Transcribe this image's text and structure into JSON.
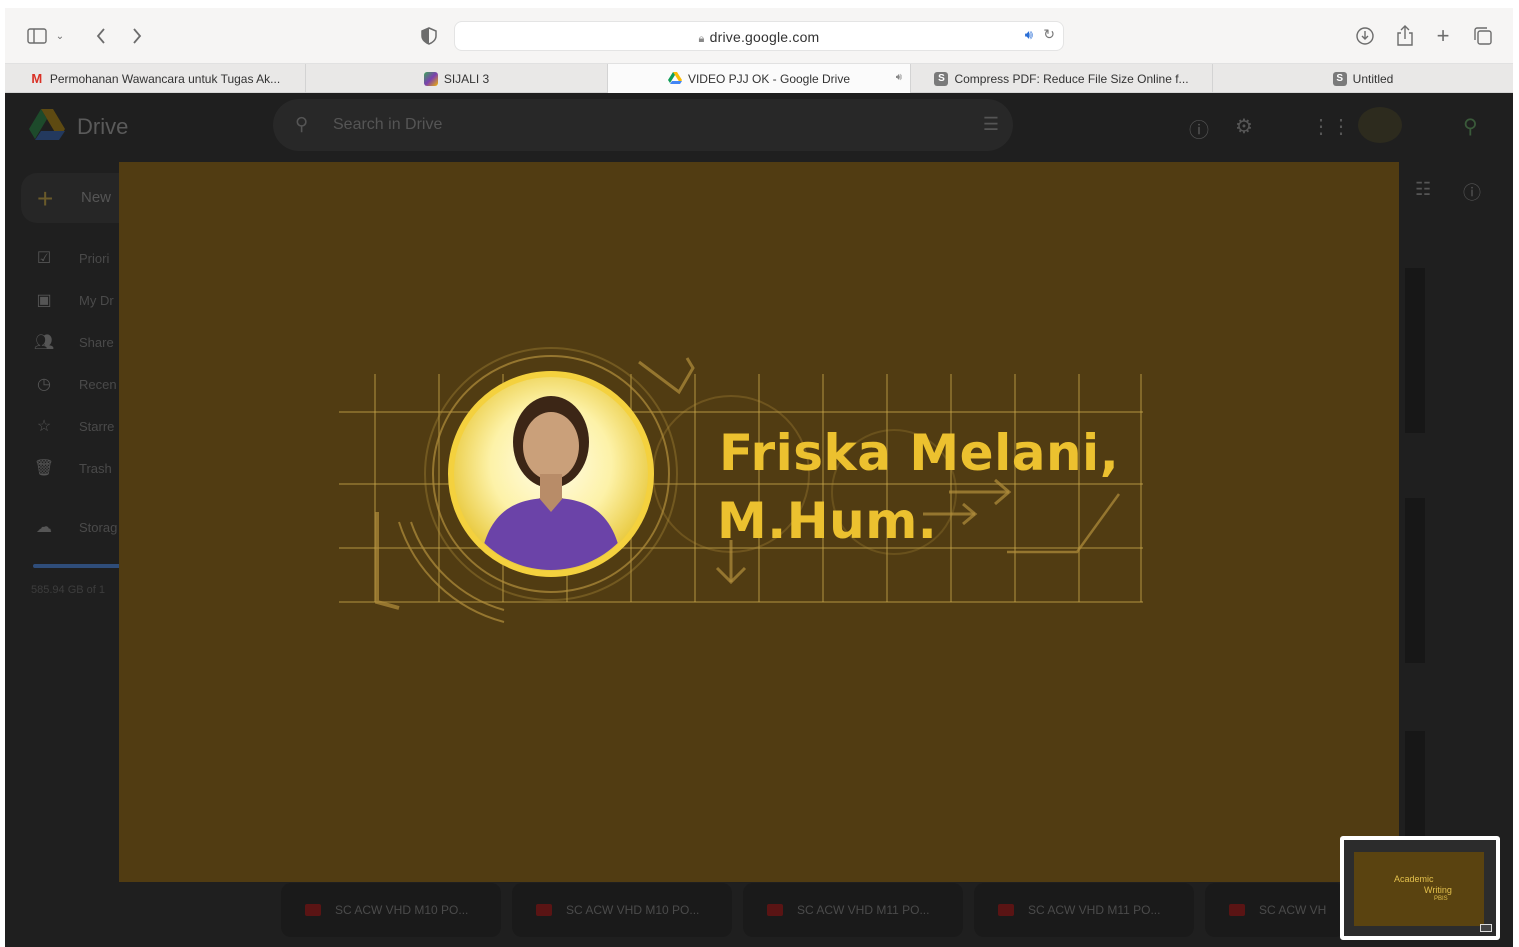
{
  "browser": {
    "url": "drive.google.com",
    "icons": [
      "sidebar-icon",
      "chevron-down-icon",
      "back-icon",
      "forward-icon",
      "privacy-shield-icon",
      "lock-icon",
      "audio-icon",
      "reload-icon",
      "download-icon",
      "share-icon",
      "new-tab-icon",
      "tab-overview-icon"
    ],
    "tabs": [
      {
        "label": "Permohanan Wawancara untuk Tugas Ak...",
        "favicon": "gmail",
        "active": false
      },
      {
        "label": "SIJALI 3",
        "favicon": "sijali",
        "active": false
      },
      {
        "label": "VIDEO PJJ OK - Google Drive",
        "favicon": "drive",
        "active": true,
        "audio": true
      },
      {
        "label": "Compress PDF: Reduce File Size Online f...",
        "favicon": "s",
        "active": false
      },
      {
        "label": "Untitled",
        "favicon": "s",
        "active": false
      }
    ]
  },
  "drive": {
    "app_title": "Drive",
    "search_placeholder": "Search in Drive",
    "new_label": "New",
    "sidebar": [
      {
        "label": "Priori",
        "icon": "priority-icon"
      },
      {
        "label": "My Dr",
        "icon": "my-drive-icon"
      },
      {
        "label": "Share",
        "icon": "shared-icon"
      },
      {
        "label": "Recen",
        "icon": "recent-icon"
      },
      {
        "label": "Starre",
        "icon": "star-icon"
      },
      {
        "label": "Trash",
        "icon": "trash-icon"
      },
      {
        "label": "Storag",
        "icon": "cloud-icon"
      }
    ],
    "storage_text": "585.94 GB of 1",
    "files": [
      "SC ACW VHD M10 PO...",
      "SC ACW VHD M10 PO...",
      "SC ACW VHD M11 PO...",
      "SC ACW VHD M11 PO...",
      "SC ACW VH"
    ]
  },
  "video": {
    "name_line1": "Friska Melani,",
    "name_line2": "M.Hum.",
    "colors": {
      "background": "#513c12",
      "accent": "#ecc12f"
    }
  },
  "pip": {
    "line1": "Academic",
    "line2": "Writing",
    "line3": "PBIS"
  }
}
